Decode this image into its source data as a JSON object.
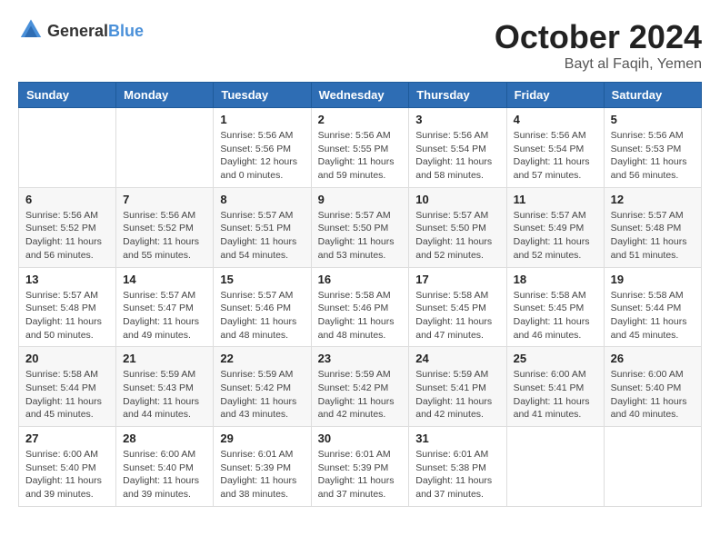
{
  "header": {
    "logo_general": "General",
    "logo_blue": "Blue",
    "month": "October 2024",
    "location": "Bayt al Faqih, Yemen"
  },
  "weekdays": [
    "Sunday",
    "Monday",
    "Tuesday",
    "Wednesday",
    "Thursday",
    "Friday",
    "Saturday"
  ],
  "weeks": [
    [
      {
        "day": "",
        "info": ""
      },
      {
        "day": "",
        "info": ""
      },
      {
        "day": "1",
        "info": "Sunrise: 5:56 AM\nSunset: 5:56 PM\nDaylight: 12 hours and 0 minutes."
      },
      {
        "day": "2",
        "info": "Sunrise: 5:56 AM\nSunset: 5:55 PM\nDaylight: 11 hours and 59 minutes."
      },
      {
        "day": "3",
        "info": "Sunrise: 5:56 AM\nSunset: 5:54 PM\nDaylight: 11 hours and 58 minutes."
      },
      {
        "day": "4",
        "info": "Sunrise: 5:56 AM\nSunset: 5:54 PM\nDaylight: 11 hours and 57 minutes."
      },
      {
        "day": "5",
        "info": "Sunrise: 5:56 AM\nSunset: 5:53 PM\nDaylight: 11 hours and 56 minutes."
      }
    ],
    [
      {
        "day": "6",
        "info": "Sunrise: 5:56 AM\nSunset: 5:52 PM\nDaylight: 11 hours and 56 minutes."
      },
      {
        "day": "7",
        "info": "Sunrise: 5:56 AM\nSunset: 5:52 PM\nDaylight: 11 hours and 55 minutes."
      },
      {
        "day": "8",
        "info": "Sunrise: 5:57 AM\nSunset: 5:51 PM\nDaylight: 11 hours and 54 minutes."
      },
      {
        "day": "9",
        "info": "Sunrise: 5:57 AM\nSunset: 5:50 PM\nDaylight: 11 hours and 53 minutes."
      },
      {
        "day": "10",
        "info": "Sunrise: 5:57 AM\nSunset: 5:50 PM\nDaylight: 11 hours and 52 minutes."
      },
      {
        "day": "11",
        "info": "Sunrise: 5:57 AM\nSunset: 5:49 PM\nDaylight: 11 hours and 52 minutes."
      },
      {
        "day": "12",
        "info": "Sunrise: 5:57 AM\nSunset: 5:48 PM\nDaylight: 11 hours and 51 minutes."
      }
    ],
    [
      {
        "day": "13",
        "info": "Sunrise: 5:57 AM\nSunset: 5:48 PM\nDaylight: 11 hours and 50 minutes."
      },
      {
        "day": "14",
        "info": "Sunrise: 5:57 AM\nSunset: 5:47 PM\nDaylight: 11 hours and 49 minutes."
      },
      {
        "day": "15",
        "info": "Sunrise: 5:57 AM\nSunset: 5:46 PM\nDaylight: 11 hours and 48 minutes."
      },
      {
        "day": "16",
        "info": "Sunrise: 5:58 AM\nSunset: 5:46 PM\nDaylight: 11 hours and 48 minutes."
      },
      {
        "day": "17",
        "info": "Sunrise: 5:58 AM\nSunset: 5:45 PM\nDaylight: 11 hours and 47 minutes."
      },
      {
        "day": "18",
        "info": "Sunrise: 5:58 AM\nSunset: 5:45 PM\nDaylight: 11 hours and 46 minutes."
      },
      {
        "day": "19",
        "info": "Sunrise: 5:58 AM\nSunset: 5:44 PM\nDaylight: 11 hours and 45 minutes."
      }
    ],
    [
      {
        "day": "20",
        "info": "Sunrise: 5:58 AM\nSunset: 5:44 PM\nDaylight: 11 hours and 45 minutes."
      },
      {
        "day": "21",
        "info": "Sunrise: 5:59 AM\nSunset: 5:43 PM\nDaylight: 11 hours and 44 minutes."
      },
      {
        "day": "22",
        "info": "Sunrise: 5:59 AM\nSunset: 5:42 PM\nDaylight: 11 hours and 43 minutes."
      },
      {
        "day": "23",
        "info": "Sunrise: 5:59 AM\nSunset: 5:42 PM\nDaylight: 11 hours and 42 minutes."
      },
      {
        "day": "24",
        "info": "Sunrise: 5:59 AM\nSunset: 5:41 PM\nDaylight: 11 hours and 42 minutes."
      },
      {
        "day": "25",
        "info": "Sunrise: 6:00 AM\nSunset: 5:41 PM\nDaylight: 11 hours and 41 minutes."
      },
      {
        "day": "26",
        "info": "Sunrise: 6:00 AM\nSunset: 5:40 PM\nDaylight: 11 hours and 40 minutes."
      }
    ],
    [
      {
        "day": "27",
        "info": "Sunrise: 6:00 AM\nSunset: 5:40 PM\nDaylight: 11 hours and 39 minutes."
      },
      {
        "day": "28",
        "info": "Sunrise: 6:00 AM\nSunset: 5:40 PM\nDaylight: 11 hours and 39 minutes."
      },
      {
        "day": "29",
        "info": "Sunrise: 6:01 AM\nSunset: 5:39 PM\nDaylight: 11 hours and 38 minutes."
      },
      {
        "day": "30",
        "info": "Sunrise: 6:01 AM\nSunset: 5:39 PM\nDaylight: 11 hours and 37 minutes."
      },
      {
        "day": "31",
        "info": "Sunrise: 6:01 AM\nSunset: 5:38 PM\nDaylight: 11 hours and 37 minutes."
      },
      {
        "day": "",
        "info": ""
      },
      {
        "day": "",
        "info": ""
      }
    ]
  ]
}
